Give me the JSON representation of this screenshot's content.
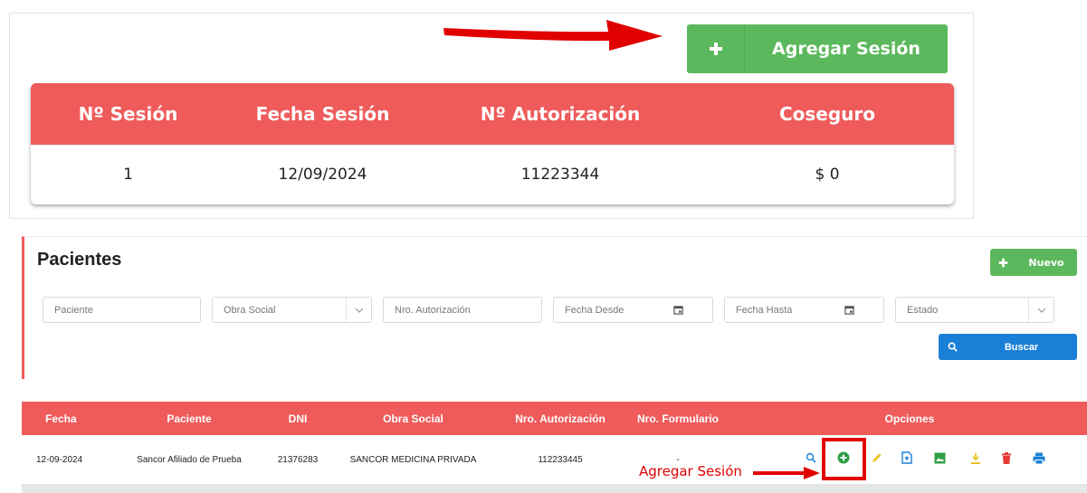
{
  "top": {
    "add_session_label": "Agregar Sesión",
    "table": {
      "headers": [
        "Nº Sesión",
        "Fecha Sesión",
        "Nº Autorización",
        "Coseguro"
      ],
      "rows": [
        [
          "1",
          "12/09/2024",
          "11223344",
          "$ 0"
        ]
      ]
    }
  },
  "patients": {
    "title": "Pacientes",
    "new_label": "Nuevo",
    "filters": {
      "paciente": "Paciente",
      "obra_social": "Obra Social",
      "nro_autorizacion": "Nro. Autorización",
      "fecha_desde": "Fecha Desde",
      "fecha_hasta": "Fecha Hasta",
      "estado": "Estado"
    },
    "search_label": "Buscar",
    "table": {
      "headers": [
        "Fecha",
        "Paciente",
        "DNI",
        "Obra Social",
        "Nro. Autorización",
        "Nro. Formulario",
        "Opciones"
      ],
      "rows": [
        [
          "12-09-2024",
          "Sancor Afiliado de Prueba",
          "21376283",
          "SANCOR MEDICINA PRIVADA",
          "112233445",
          "-"
        ]
      ]
    },
    "option_icons": [
      "search-icon",
      "add-circle-icon",
      "pencil-icon",
      "file-upload-icon",
      "image-icon",
      "download-icon",
      "trash-icon",
      "print-icon"
    ]
  },
  "annotation": {
    "label": "Agregar Sesión"
  },
  "colors": {
    "header_red": "#ef5b5b",
    "success_green": "#5cb85c",
    "primary_blue": "#1a7fd6",
    "annotation_red": "#e10000"
  }
}
